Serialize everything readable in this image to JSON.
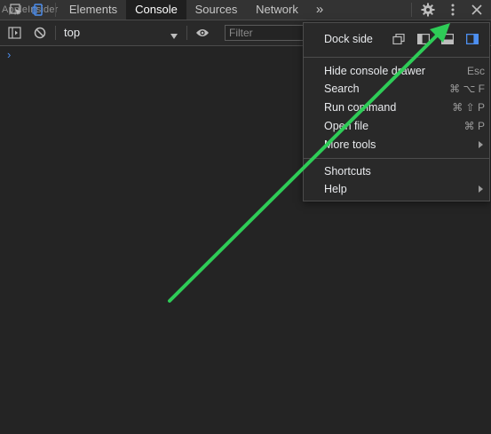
{
  "watermark": "AppleInsider",
  "tabs": [
    {
      "label": "Elements",
      "active": false
    },
    {
      "label": "Console",
      "active": true
    },
    {
      "label": "Sources",
      "active": false
    },
    {
      "label": "Network",
      "active": false
    }
  ],
  "overflow_label": "»",
  "toolbar": {
    "context": "top",
    "filter_placeholder": "Filter"
  },
  "console": {
    "prompt": "›"
  },
  "menu": {
    "dock_side_label": "Dock side",
    "dock_options": [
      "undock-icon",
      "dock-left-icon",
      "dock-bottom-icon",
      "dock-right-icon"
    ],
    "dock_selected": "dock-right-icon",
    "items": [
      {
        "label": "Hide console drawer",
        "shortcut": "Esc"
      },
      {
        "label": "Search",
        "shortcut": "⌘ ⌥ F"
      },
      {
        "label": "Run command",
        "shortcut": "⌘ ⇧ P"
      },
      {
        "label": "Open file",
        "shortcut": "⌘ P"
      },
      {
        "label": "More tools",
        "shortcut": ""
      }
    ],
    "items2": [
      {
        "label": "Shortcuts"
      },
      {
        "label": "Help"
      }
    ]
  },
  "colors": {
    "accent_blue": "#4d8ff0",
    "annotation_arrow": "#2ecc57",
    "background": "#242424"
  }
}
